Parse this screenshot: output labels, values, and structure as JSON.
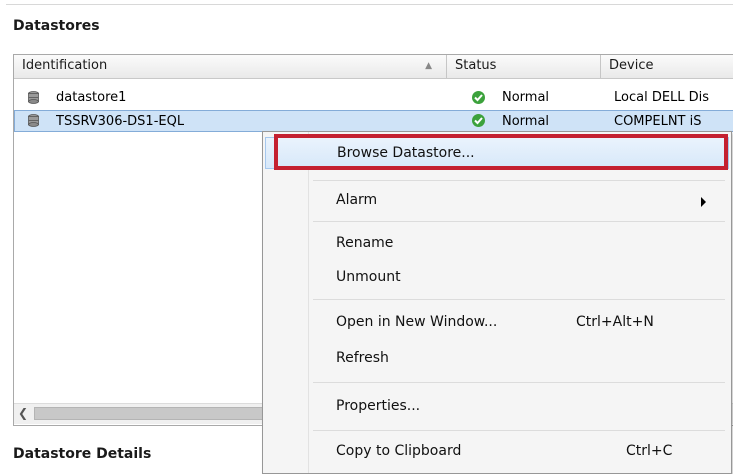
{
  "sections": {
    "datastores_title": "Datastores",
    "details_title": "Datastore Details"
  },
  "grid": {
    "columns": [
      "Identification",
      "Status",
      "Device"
    ],
    "rows": [
      {
        "identification": "datastore1",
        "status": "Normal",
        "device": "Local DELL Dis"
      },
      {
        "identification": "TSSRV306-DS1-EQL",
        "status": "Normal",
        "device": "COMPELNT iS"
      }
    ],
    "selected_row": 1,
    "status_color": "#3ca23c",
    "selection_color": "#cfe3f7"
  },
  "context_menu": {
    "items": [
      {
        "label": "Browse Datastore...",
        "shortcut": ""
      },
      {
        "label": "Alarm",
        "shortcut": "",
        "submenu": true
      },
      {
        "label": "Rename",
        "shortcut": ""
      },
      {
        "label": "Unmount",
        "shortcut": ""
      },
      {
        "label": "Open in New Window...",
        "shortcut": "Ctrl+Alt+N"
      },
      {
        "label": "Refresh",
        "shortcut": ""
      },
      {
        "label": "Properties...",
        "shortcut": ""
      },
      {
        "label": "Copy to Clipboard",
        "shortcut": "Ctrl+C"
      }
    ],
    "highlight_color": "#c42030"
  }
}
